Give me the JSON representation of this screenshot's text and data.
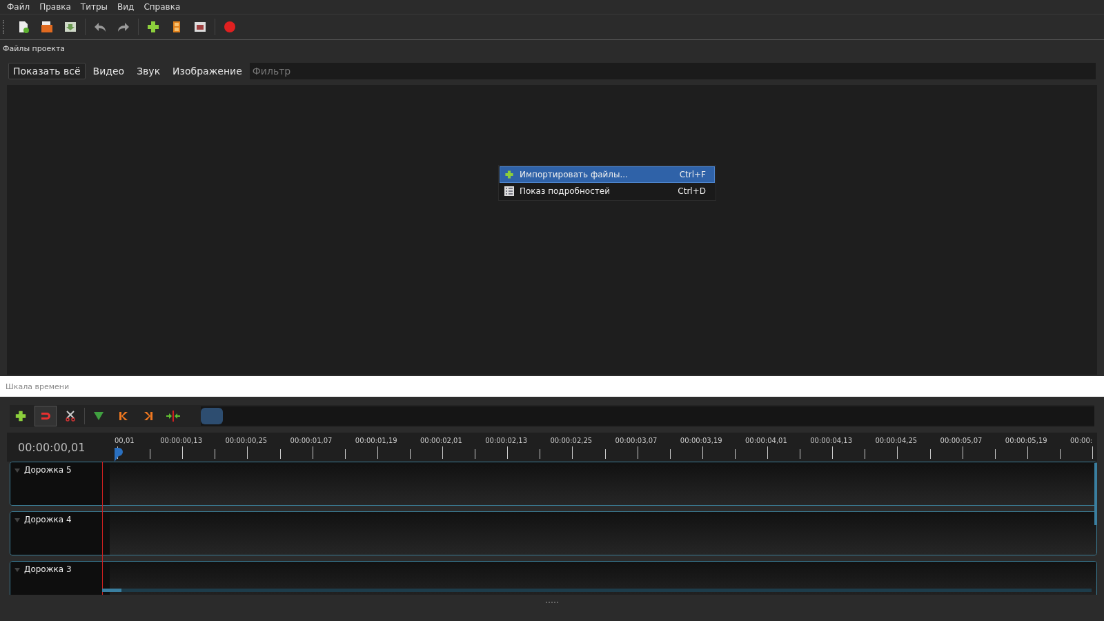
{
  "menu_bar": [
    "Файл",
    "Правка",
    "Титры",
    "Вид",
    "Справка"
  ],
  "toolbar": [
    {
      "kind": "new"
    },
    {
      "kind": "open"
    },
    {
      "kind": "save"
    },
    {
      "kind": "sep"
    },
    {
      "kind": "undo"
    },
    {
      "kind": "redo"
    },
    {
      "kind": "sep"
    },
    {
      "kind": "import"
    },
    {
      "kind": "profile"
    },
    {
      "kind": "fullscreen"
    },
    {
      "kind": "sep"
    },
    {
      "kind": "record"
    }
  ],
  "project_files": {
    "title": "Файлы проекта",
    "filters": [
      {
        "label": "Показать всё",
        "selected": true
      },
      {
        "label": "Видео",
        "selected": false
      },
      {
        "label": "Звук",
        "selected": false
      },
      {
        "label": "Изображение",
        "selected": false
      }
    ],
    "search": {
      "placeholder": "Фильтр"
    },
    "context_menu": [
      {
        "kind": "import",
        "label": "Импортировать файлы...",
        "shortcut": "Ctrl+F",
        "selected": true
      },
      {
        "kind": "details",
        "label": "Показ подробностей",
        "shortcut": "Ctrl+D",
        "selected": false
      }
    ]
  },
  "timeline": {
    "title": "Шкала времени",
    "tools": [
      {
        "kind": "add",
        "on": false
      },
      {
        "kind": "snap",
        "on": true
      },
      {
        "kind": "razor",
        "on": false
      },
      {
        "kind": "sep"
      },
      {
        "kind": "marker",
        "on": false
      },
      {
        "kind": "prev",
        "on": false
      },
      {
        "kind": "next",
        "on": false
      },
      {
        "kind": "center",
        "on": false
      }
    ],
    "zoom": {
      "level": 0.0
    },
    "current_time": "00:00:00,01",
    "ruler": [
      "00,01",
      "00:00:00,13",
      "00:00:00,25",
      "00:00:01,07",
      "00:00:01,19",
      "00:00:02,01",
      "00:00:02,13",
      "00:00:02,25",
      "00:00:03,07",
      "00:00:03,19",
      "00:00:04,01",
      "00:00:04,13",
      "00:00:04,25",
      "00:00:05,07",
      "00:00:05,19",
      "00:00:"
    ],
    "tracks": [
      {
        "name": "Дорожка 5",
        "expanded": true
      },
      {
        "name": "Дорожка 4",
        "expanded": true
      },
      {
        "name": "Дорожка 3",
        "expanded": true
      }
    ]
  }
}
